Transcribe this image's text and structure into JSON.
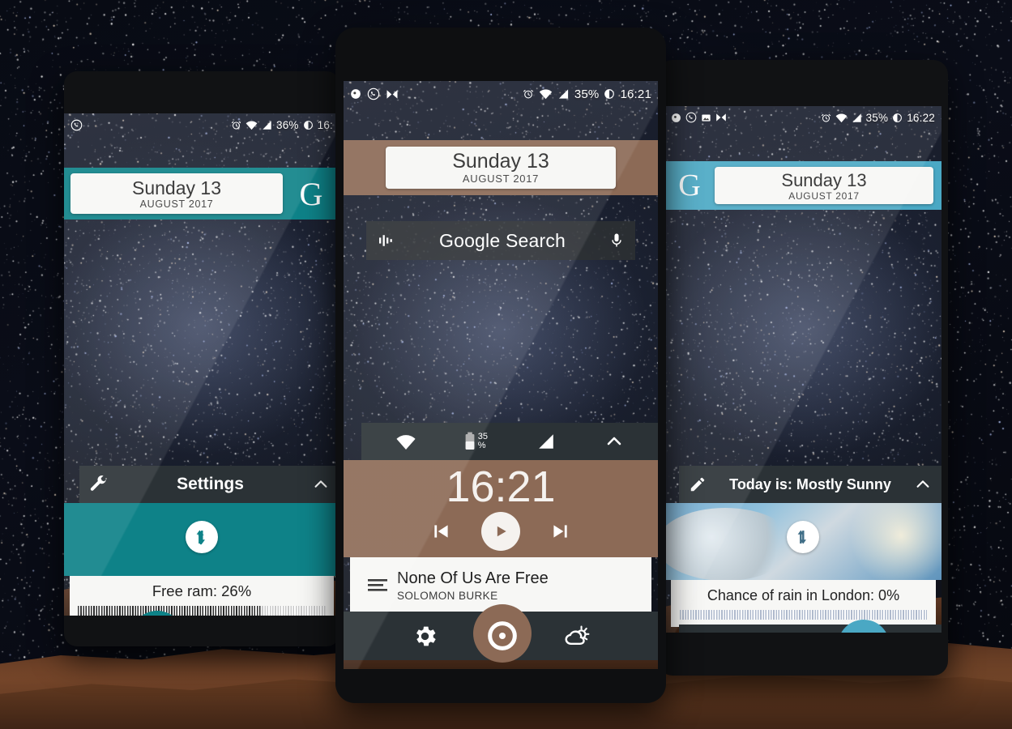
{
  "scene": {
    "name": "android-homescreen-widget-showcase",
    "background": "starfield-with-mars-horizon"
  },
  "phones": [
    {
      "id": "left-phone",
      "accent": "#0e8288",
      "statusbar": {
        "left_icons": [
          "whatsapp-icon"
        ],
        "right_icons": [
          "alarm-icon",
          "wifi-icon",
          "signal-icon",
          "moon-icon"
        ],
        "battery": "36%",
        "clock": "16:"
      },
      "date_widget": {
        "day": "Sunday 13",
        "month": "AUGUST 2017",
        "logo": "G",
        "logo_side": "right"
      },
      "widget": {
        "header_icon": "wrench-icon",
        "header_title": "Settings",
        "collapse_icon": "chevron-up-icon",
        "sync_icon": "sync-arrows-icon",
        "info_text": "Free ram: 26%",
        "progress_percent": 74,
        "progress_style": "striped"
      },
      "dock": [
        {
          "icon": "gear-icon",
          "label": "settings",
          "selected": true
        },
        {
          "icon": "disc-icon",
          "label": "music",
          "selected": false
        },
        {
          "icon": "partly-cloudy-icon",
          "label": "weather",
          "selected": false
        }
      ]
    },
    {
      "id": "center-phone",
      "accent": "#8c6a56",
      "statusbar": {
        "left_icons": [
          "snapchat-icon",
          "whatsapp-icon",
          "media-icon"
        ],
        "right_icons": [
          "alarm-icon",
          "wifi-icon",
          "signal-icon",
          "moon-icon"
        ],
        "battery": "35%",
        "clock": "16:21"
      },
      "date_widget": {
        "day": "Sunday 13",
        "month": "AUGUST 2017",
        "logo": "",
        "logo_side": "none"
      },
      "search": {
        "left_icon": "equalizer-icon",
        "label": "Google Search",
        "right_icon": "microphone-icon"
      },
      "widget": {
        "header_icons": [
          "wifi-icon",
          "battery-icon",
          "signal-icon"
        ],
        "header_battery": "35\n%",
        "header_battery_value": "35",
        "header_battery_unit": "%",
        "collapse_icon": "chevron-up-icon",
        "clock": "16:21",
        "transport": [
          "previous-icon",
          "play-icon",
          "next-icon"
        ],
        "track_title": "None Of Us Are Free",
        "track_artist": "SOLOMON BURKE",
        "playlist_icon": "playlist-icon"
      },
      "dock": [
        {
          "icon": "gear-icon",
          "label": "settings",
          "selected": false
        },
        {
          "icon": "disc-icon",
          "label": "music",
          "selected": true
        },
        {
          "icon": "partly-cloudy-icon",
          "label": "weather",
          "selected": false
        }
      ]
    },
    {
      "id": "right-phone",
      "accent": "#4aa8c4",
      "statusbar": {
        "left_icons": [
          "snapchat-icon",
          "whatsapp-icon",
          "photo-icon",
          "media-icon"
        ],
        "right_icons": [
          "alarm-icon",
          "wifi-icon",
          "signal-icon",
          "moon-icon"
        ],
        "battery": "35%",
        "clock": "16:22"
      },
      "date_widget": {
        "day": "Sunday 13",
        "month": "AUGUST 2017",
        "logo": "G",
        "logo_side": "left"
      },
      "widget": {
        "header_icon": "pencil-icon",
        "header_title": "Today is: Mostly Sunny",
        "collapse_icon": "chevron-up-icon",
        "sync_icon": "sync-arrows-icon",
        "info_text": "Chance of rain in London: 0%",
        "progress_percent": 100,
        "progress_style": "striped-light"
      },
      "dock": [
        {
          "icon": "gear-icon",
          "label": "settings",
          "selected": false
        },
        {
          "icon": "disc-icon",
          "label": "music",
          "selected": false
        },
        {
          "icon": "partly-cloudy-icon",
          "label": "weather",
          "selected": true
        }
      ]
    }
  ]
}
